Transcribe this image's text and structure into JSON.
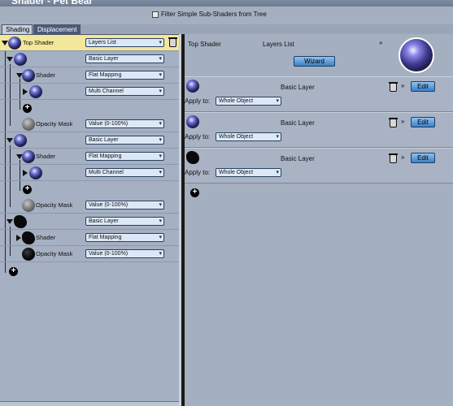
{
  "window": {
    "title": "Shader - Pet Bear"
  },
  "filter": {
    "label": "Filter Simple Sub-Shaders from Tree",
    "checked": false
  },
  "tabs": [
    {
      "label": "Shading",
      "active": true
    },
    {
      "label": "Displacement",
      "active": false
    }
  ],
  "tree": {
    "rows": [
      {
        "kind": "top",
        "label": "Top Shader",
        "value": "Layers List"
      },
      {
        "kind": "layer",
        "label": "",
        "value": "Basic Layer"
      },
      {
        "kind": "shader",
        "label": "Shader",
        "value": "Flat Mapping"
      },
      {
        "kind": "sub",
        "label": "",
        "value": "Multi Channel"
      },
      {
        "kind": "add",
        "label": ""
      },
      {
        "kind": "opacity",
        "label": "Opacity Mask",
        "value": "Value (0-100%)"
      },
      {
        "kind": "layer",
        "label": "",
        "value": "Basic Layer"
      },
      {
        "kind": "shader",
        "label": "Shader",
        "value": "Flat Mapping"
      },
      {
        "kind": "sub",
        "label": "",
        "value": "Multi Channel"
      },
      {
        "kind": "add",
        "label": ""
      },
      {
        "kind": "opacity",
        "label": "Opacity Mask",
        "value": "Value (0-100%)"
      },
      {
        "kind": "layer",
        "label": "",
        "value": "Basic Layer"
      },
      {
        "kind": "shader",
        "label": "Shader",
        "value": "Flat Mapping"
      },
      {
        "kind": "opacity",
        "label": "Opacity Mask",
        "value": "Value (0-100%)"
      },
      {
        "kind": "add",
        "label": ""
      }
    ]
  },
  "detail": {
    "title": "Top Shader",
    "type": "Layers List",
    "wizard_label": "Wizard",
    "layers": [
      {
        "name": "Basic Layer",
        "apply_label": "Apply to:",
        "apply_value": "Whole Object",
        "edit_label": "Edit"
      },
      {
        "name": "Basic Layer",
        "apply_label": "Apply to:",
        "apply_value": "Whole Object",
        "edit_label": "Edit"
      },
      {
        "name": "Basic Layer",
        "apply_label": "Apply to:",
        "apply_value": "Whole Object",
        "edit_label": "Edit"
      }
    ]
  },
  "icons": {
    "collapse": "triangle-down-icon",
    "expand": "triangle-right-icon",
    "add": "plus-circle-icon",
    "delete": "trash-icon",
    "more": "double-chevron-down-icon",
    "dropdown": "dropdown-arrow-icon"
  },
  "colors": {
    "selected_row": "#f2e79a",
    "button": "#3c7fc4",
    "panel": "#a5b0c2"
  }
}
